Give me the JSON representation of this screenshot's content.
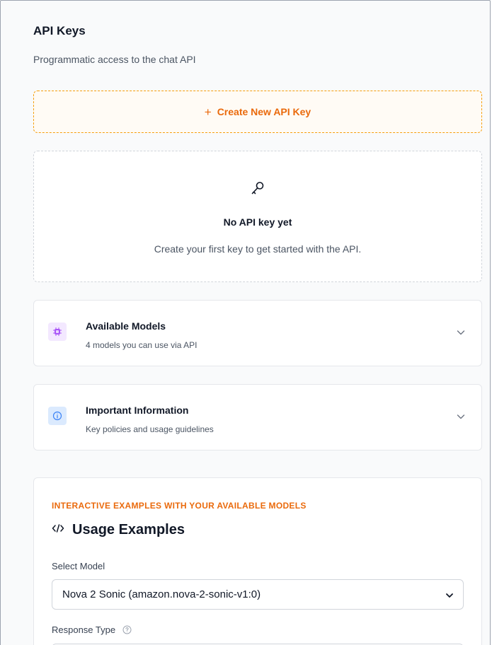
{
  "header": {
    "title": "API Keys",
    "subtitle": "Programmatic access to the chat API"
  },
  "create_button": {
    "icon": "plus-icon",
    "label": "Create New API Key",
    "color": "#ea6a0c",
    "border_color": "#f59e0b"
  },
  "empty_state": {
    "icon": "key-icon",
    "title": "No API key yet",
    "description": "Create your first key to get started with the API."
  },
  "accordions": [
    {
      "icon": "chip-icon",
      "title": "Available Models",
      "description": "4 models you can use via API",
      "expanded": false,
      "icon_bg": "#f3e8ff",
      "icon_color": "#a855f7"
    },
    {
      "icon": "info-icon",
      "title": "Important Information",
      "description": "Key policies and usage guidelines",
      "expanded": false,
      "icon_bg": "#dbeafe",
      "icon_color": "#3b82f6"
    }
  ],
  "usage_examples": {
    "eyebrow": "INTERACTIVE EXAMPLES WITH YOUR AVAILABLE MODELS",
    "icon": "code-icon",
    "title": "Usage Examples",
    "select_model_label": "Select Model",
    "selected_model": "Nova 2 Sonic (amazon.nova-2-sonic-v1:0)",
    "response_type_label": "Response Type"
  }
}
